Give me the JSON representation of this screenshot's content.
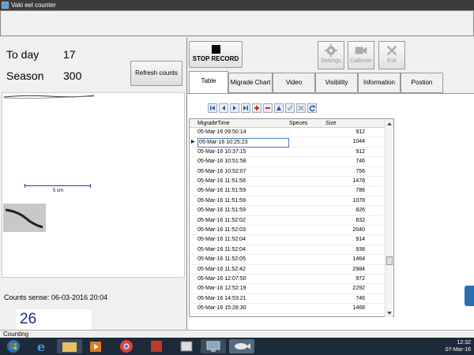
{
  "window": {
    "title": "Vaki eel counter"
  },
  "counts": {
    "today_label": "To day",
    "today_value": "17",
    "season_label": "Season",
    "season_value": "300",
    "refresh_label": "Refresh counts"
  },
  "image_panel": {
    "scale_label": "5 cm"
  },
  "counts_sense": "Counts sense: 06-03-2016 20:04",
  "big_count": "26",
  "status": "Counting",
  "toolbar": {
    "stop_label": "STOP RECORD",
    "settings_label": "Settings",
    "calibrate_label": "Calibrate",
    "exit_label": "Exit"
  },
  "tabs": [
    "Table",
    "Migrade Chart",
    "Video",
    "Visibility",
    "Information",
    "Postion"
  ],
  "table": {
    "columns": [
      "MigradeTime",
      "Speces",
      "Size"
    ],
    "rows": [
      [
        "05-Mar-16 09:50:14",
        "",
        "912"
      ],
      [
        "05-Mar-16 10:25:23",
        "",
        "1044"
      ],
      [
        "05-Mar-16 10:37:15",
        "",
        "912"
      ],
      [
        "05-Mar-16 10:51:58",
        "",
        "746"
      ],
      [
        "05-Mar-16 10:52:07",
        "",
        "756"
      ],
      [
        "05-Mar-16 11:51:58",
        "",
        "1478"
      ],
      [
        "05-Mar-16 11:51:59",
        "",
        "786"
      ],
      [
        "05-Mar-16 11:51:59",
        "",
        "1078"
      ],
      [
        "05-Mar-16 11:51:59",
        "",
        "826"
      ],
      [
        "05-Mar-16 11:52:02",
        "",
        "832"
      ],
      [
        "05-Mar-16 11:52:03",
        "",
        "2040"
      ],
      [
        "05-Mar-16 11:52:04",
        "",
        "914"
      ],
      [
        "05-Mar-16 11:52:04",
        "",
        "938"
      ],
      [
        "05-Mar-16 11:52:05",
        "",
        "1464"
      ],
      [
        "05-Mar-16 11:52:42",
        "",
        "2984"
      ],
      [
        "05-Mar-16 12:07:50",
        "",
        "972"
      ],
      [
        "05-Mar-16 12:52:19",
        "",
        "2292"
      ],
      [
        "05-Mar-16 14:53:21",
        "",
        "746"
      ],
      [
        "05-Mar-16 15:28:30",
        "",
        "1468"
      ]
    ],
    "selected_row": 1
  },
  "taskbar": {
    "time": "12:32",
    "date": "07-Mar-16"
  },
  "colors": {
    "count_blue": "#1b2b8a",
    "taskbar": "#1c2a3a"
  }
}
